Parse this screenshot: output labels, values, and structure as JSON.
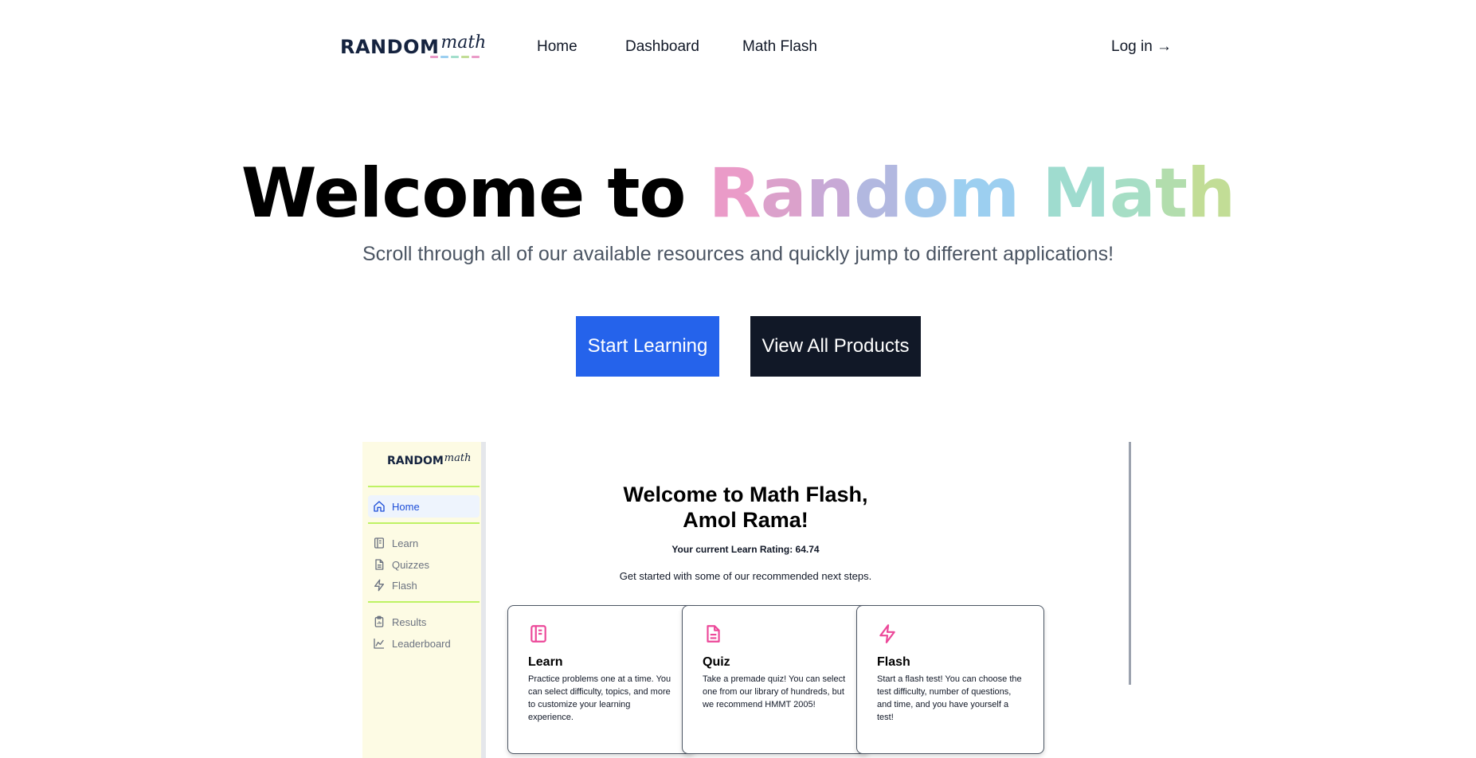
{
  "nav": {
    "logo_main": "RANDOM",
    "logo_sub": "math",
    "links": [
      {
        "label": "Home"
      },
      {
        "label": "Dashboard"
      },
      {
        "label": "Math Flash"
      }
    ],
    "login_label": "Log in →"
  },
  "colors": {
    "primary_button": "#2563eb",
    "dark_button": "#111827",
    "pink": "#ea9bc8",
    "purple": "#c4a8d8",
    "blue": "#9ccff0",
    "green": "#a3dfcc",
    "lime": "#c2dd96",
    "icon_pink": "#ec4899"
  },
  "hero": {
    "title_prefix": "Welcome to ",
    "title_letters": [
      "R",
      "a",
      "n",
      "d",
      "o",
      "m",
      " ",
      "M",
      "a",
      "t",
      "h"
    ],
    "subtitle": "Scroll through all of our available resources and quickly jump to different applications!",
    "start_button": "Start Learning",
    "products_button": "View All Products"
  },
  "preview": {
    "sidebar": {
      "logo_main": "RANDOM",
      "logo_sub": "math",
      "items": [
        {
          "label": "Home",
          "icon": "home-icon"
        },
        {
          "label": "Learn",
          "icon": "notebook-icon"
        },
        {
          "label": "Quizzes",
          "icon": "document-icon"
        },
        {
          "label": "Flash",
          "icon": "lightning-icon"
        },
        {
          "label": "Results",
          "icon": "clipboard-icon"
        },
        {
          "label": "Leaderboard",
          "icon": "chart-icon"
        }
      ]
    },
    "title_line1": "Welcome to Math Flash,",
    "title_line2": "Amol Rama!",
    "rating": "Your current Learn Rating: 64.74",
    "steps": "Get started with some of our recommended next steps.",
    "cards": [
      {
        "title": "Learn",
        "icon": "notebook-icon",
        "text": "Practice problems one at a time. You can select difficulty, topics, and more to customize your learning experience."
      },
      {
        "title": "Quiz",
        "icon": "document-icon",
        "text": "Take a premade quiz! You can select one from our library of hundreds, but we recommend HMMT 2005!"
      },
      {
        "title": "Flash",
        "icon": "lightning-icon",
        "text": "Start a flash test! You can choose the test difficulty, number of questions, and time, and you have yourself a test!"
      }
    ]
  }
}
